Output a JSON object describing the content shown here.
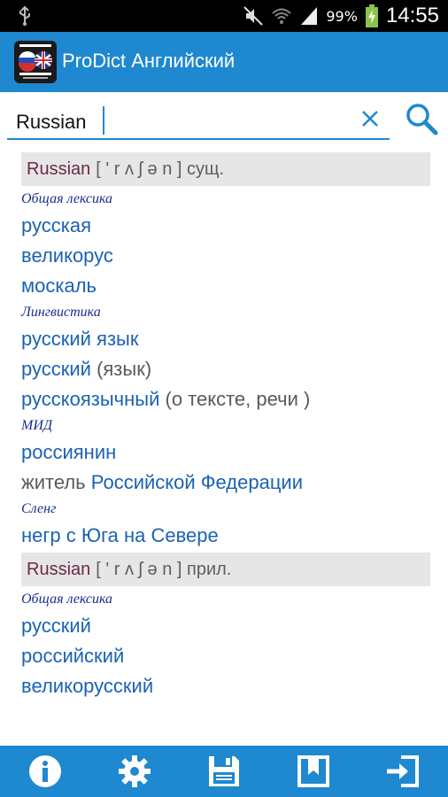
{
  "status_bar": {
    "battery_percent": "99%",
    "time": "14:55",
    "icons": [
      "usb-icon",
      "mute-icon",
      "wifi-icon",
      "signal-icon",
      "battery-charging-icon"
    ]
  },
  "action_bar": {
    "title": "ProDict Английский",
    "logo_icon": "prodict-flags-logo"
  },
  "search": {
    "value": "Russian",
    "clear_icon": "close-icon",
    "search_icon": "search-icon"
  },
  "entries": [
    {
      "headword": "Russian",
      "transcription": "[ ' r ʌ ʃ ə n ] сущ.",
      "sections": [
        {
          "domain": "Общая лексика",
          "items": [
            {
              "link": "русская",
              "note": ""
            },
            {
              "link": "великорус",
              "note": ""
            },
            {
              "link": "москаль",
              "note": ""
            }
          ]
        },
        {
          "domain": "Лингвистика",
          "items": [
            {
              "link": "русский язык",
              "note": ""
            },
            {
              "link": "русский",
              "note": " (язык)"
            },
            {
              "link": "русскоязычный",
              "note": " (о тексте, речи )"
            }
          ]
        },
        {
          "domain": "МИД",
          "items": [
            {
              "link": "россиянин",
              "note": ""
            },
            {
              "prefix": "житель ",
              "link": "Российской Федерации",
              "note": ""
            }
          ]
        },
        {
          "domain": "Сленг",
          "items": [
            {
              "link": "негр с Юга на Севере",
              "note": ""
            }
          ]
        }
      ]
    },
    {
      "headword": "Russian",
      "transcription": "[ ' r ʌ ʃ ə n ] прил.",
      "sections": [
        {
          "domain": "Общая лексика",
          "items": [
            {
              "link": "русский",
              "note": ""
            },
            {
              "link": "российский",
              "note": ""
            },
            {
              "link": "великорусский",
              "note": ""
            }
          ]
        }
      ]
    }
  ],
  "toolbar": {
    "buttons": [
      "info-icon",
      "settings-gear-icon",
      "save-floppy-icon",
      "bookmark-icon",
      "exit-icon"
    ]
  },
  "colors": {
    "accent": "#1e88d0",
    "link": "#1b62b4",
    "headword": "#6a2a48",
    "domain": "#1a2d8c"
  }
}
